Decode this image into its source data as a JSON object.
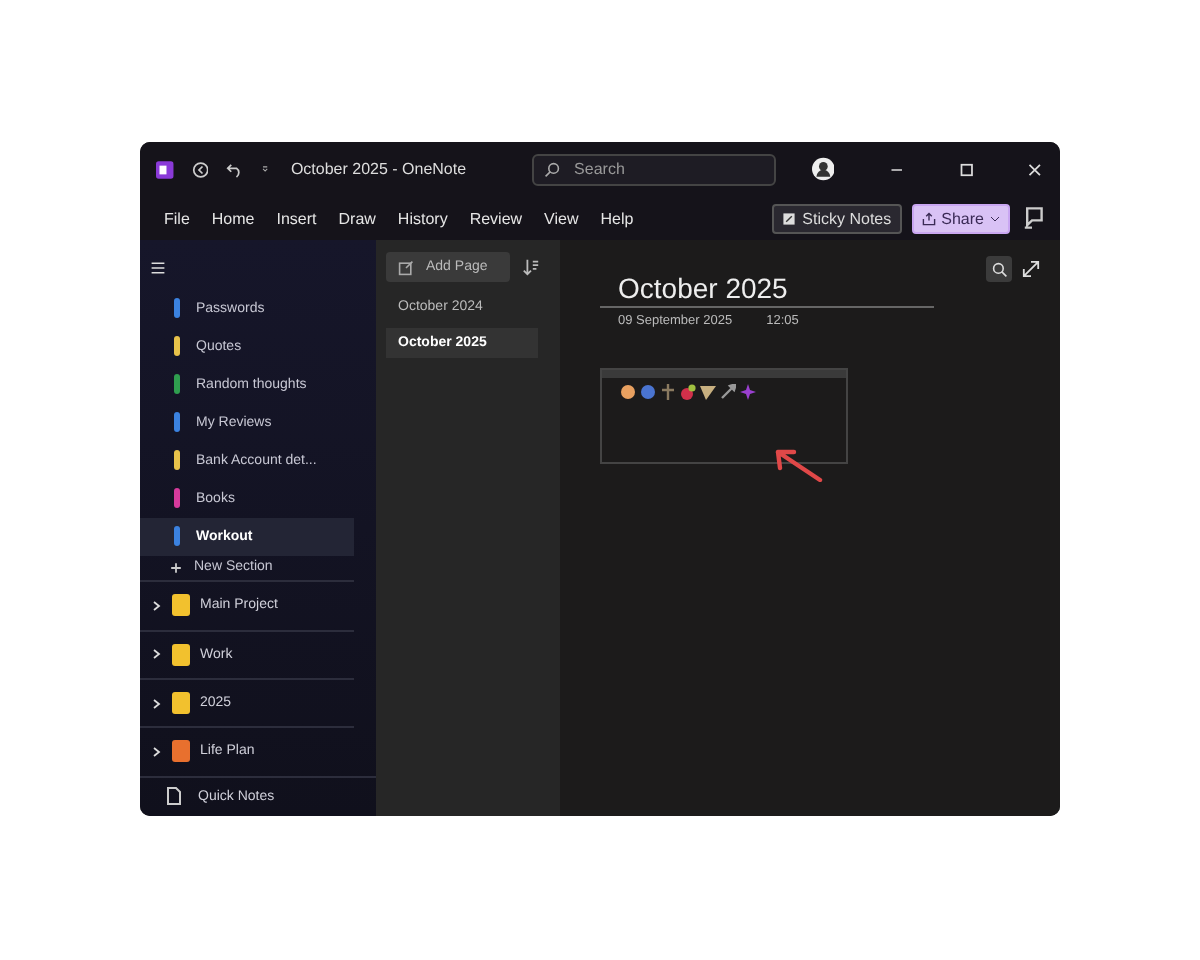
{
  "window": {
    "title": "October 2025 - OneNote"
  },
  "search": {
    "placeholder": "Search"
  },
  "menu": [
    {
      "label": "File"
    },
    {
      "label": "Home"
    },
    {
      "label": "Insert"
    },
    {
      "label": "Draw"
    },
    {
      "label": "History"
    },
    {
      "label": "Review"
    },
    {
      "label": "View"
    },
    {
      "label": "Help"
    }
  ],
  "ribbon_buttons": [
    {
      "label": "Sticky Notes",
      "kind": "sticky"
    },
    {
      "label": "Share",
      "kind": "share"
    }
  ],
  "sections": [
    {
      "label": "Passwords",
      "color": "#3b82e0",
      "selected": false
    },
    {
      "label": "Quotes",
      "color": "#e8c24a",
      "selected": false
    },
    {
      "label": "Random thoughts",
      "color": "#2f9e4f",
      "selected": false
    },
    {
      "label": "My Reviews",
      "color": "#3b82e0",
      "selected": false
    },
    {
      "label": "Bank Account det...",
      "color": "#e8c24a",
      "selected": false
    },
    {
      "label": "Books",
      "color": "#d63a9c",
      "selected": false
    },
    {
      "label": "Workout",
      "color": "#3b82e0",
      "selected": true
    }
  ],
  "new_section": "New Section",
  "notebooks": [
    {
      "label": "Main Project",
      "color": "#f2c12e"
    },
    {
      "label": "Work",
      "color": "#f2c12e"
    },
    {
      "label": "2025",
      "color": "#f2c12e"
    },
    {
      "label": "Life Plan",
      "color": "#e8702e"
    }
  ],
  "quick_notes": "Quick Notes",
  "add_page": "Add Page",
  "pages": [
    {
      "label": "October 2024",
      "selected": false
    },
    {
      "label": "October 2025",
      "selected": true
    }
  ],
  "note": {
    "title": "October 2025",
    "date": "09 September 2025",
    "time": "12:05"
  }
}
